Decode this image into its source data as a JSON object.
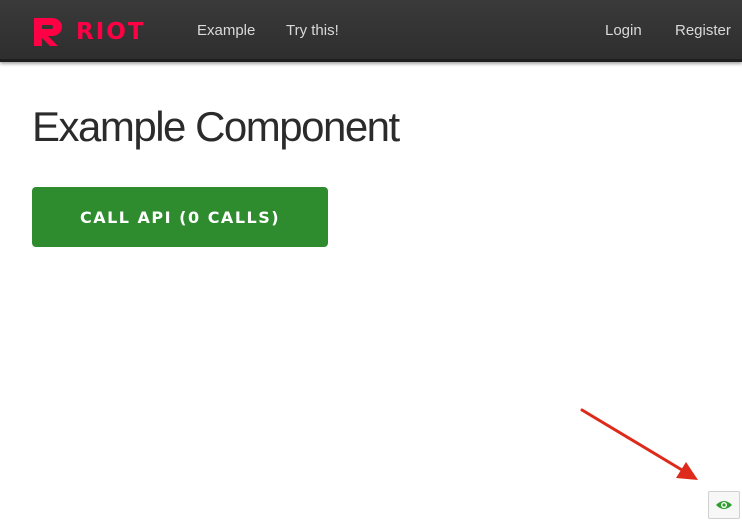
{
  "navbar": {
    "brand_text": "RIOT",
    "brand_color": "#ff0044",
    "logo_icon": "riot-logo-icon",
    "links": {
      "example": "Example",
      "try_this": "Try this!",
      "login": "Login",
      "register": "Register"
    }
  },
  "main": {
    "title": "Example Component",
    "call_button_label": "CALL API (0 CALLS)",
    "call_button_color": "#2e8b2e"
  },
  "annotation": {
    "arrow_color": "#dd2a1b"
  },
  "corner_button": {
    "icon": "eye-icon",
    "icon_color": "#2e9e2e"
  }
}
